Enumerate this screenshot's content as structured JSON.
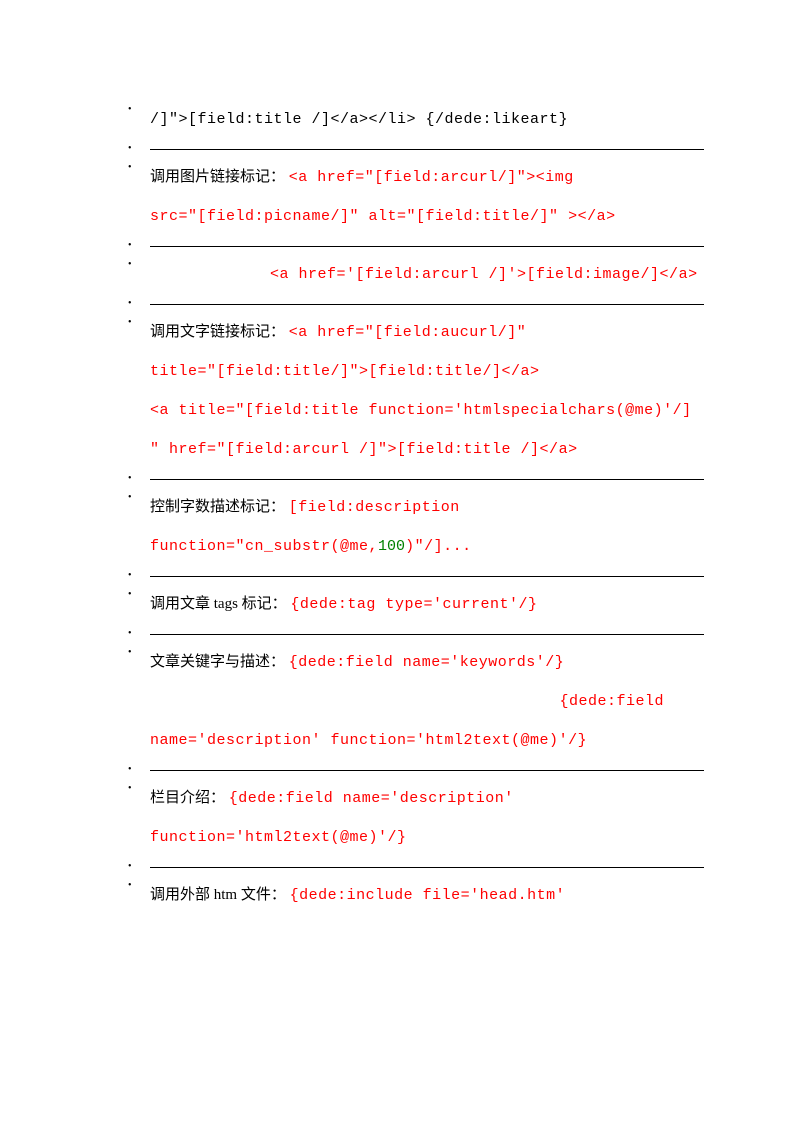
{
  "line0": "/]\">[field:title /]</a></li> {/dede:likeart}",
  "item1": {
    "label": "调用图片链接标记：",
    "code_a": "<a href=\"[field:arcurl/]\"><img",
    "code_b": "src=\"[field:picname/]\" alt=\"[field:title/]\" ></a>"
  },
  "item2": {
    "code": "<a href='[field:arcurl /]'>[field:image/]</a>"
  },
  "item3": {
    "label": "调用文字链接标记：",
    "code_a": "<a href=\"[field:aucurl/]\"",
    "code_b": "title=\"[field:title/]\">[field:title/]</a>",
    "code_c": "<a title=\"[field:title function='htmlspecialchars(@me)'/]",
    "code_d": "\" href=\"[field:arcurl /]\">[field:title /]</a>"
  },
  "item4": {
    "label": "控制字数描述标记：",
    "code_a": "[field:description",
    "code_b": "function=\"cn_substr(@me,",
    "num": "100",
    "code_c": ")\"/]..."
  },
  "item5": {
    "label": "调用文章 tags 标记：",
    "code": "{dede:tag type='current'/}"
  },
  "item6": {
    "label": "文章关键字与描述：",
    "code_a": "{dede:field name='keywords'/}",
    "code_b": "{dede:field",
    "code_c": "name='description' function='html2text(@me)'/}"
  },
  "item7": {
    "label": "栏目介绍：",
    "code_a": "{dede:field name='description'",
    "code_b": "function='html2text(@me)'/}"
  },
  "item8": {
    "label": "调用外部 htm 文件：",
    "code": "{dede:include file='head.htm'"
  }
}
